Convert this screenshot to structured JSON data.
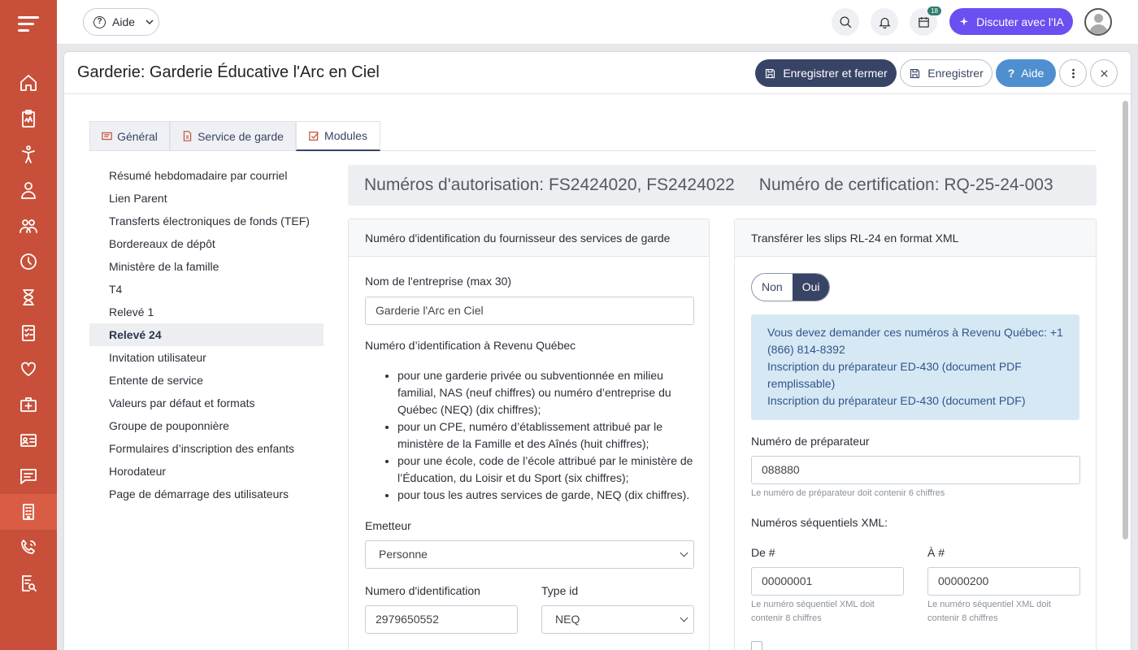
{
  "topbar": {
    "help_label": "Aide",
    "calendar_badge": "18",
    "ai_button": "Discuter avec l'IA"
  },
  "header": {
    "title": "Garderie: Garderie Éducative l'Arc en Ciel",
    "save_close": "Enregistrer et fermer",
    "save": "Enregistrer",
    "help": "Aide"
  },
  "tabs": [
    {
      "label": "Général"
    },
    {
      "label": "Service de garde"
    },
    {
      "label": "Modules"
    }
  ],
  "sidebar": {
    "items": [
      {
        "label": "Résumé hebdomadaire par courriel"
      },
      {
        "label": "Lien Parent"
      },
      {
        "label": "Transferts électroniques de fonds (TEF)"
      },
      {
        "label": "Bordereaux de dépôt"
      },
      {
        "label": "Ministère de la famille"
      },
      {
        "label": "T4"
      },
      {
        "label": "Relevé 1"
      },
      {
        "label": "Relevé 24"
      },
      {
        "label": "Invitation utilisateur"
      },
      {
        "label": "Entente de service"
      },
      {
        "label": "Valeurs par défaut et formats"
      },
      {
        "label": "Groupe de pouponnière"
      },
      {
        "label": "Formulaires d’inscription des enfants"
      },
      {
        "label": "Horodateur"
      },
      {
        "label": "Page de démarrage des utilisateurs"
      }
    ],
    "active_index": 7
  },
  "cert": {
    "authorization": "Numéros d'autorisation: FS2424020, FS2424022",
    "certification": "Numéro de certification: RQ-25-24-003"
  },
  "left_card": {
    "title": "Numéro d'identification du fournisseur des services de garde",
    "company_label": "Nom de l'entreprise (max 30)",
    "company_value": "Garderie l'Arc en Ciel",
    "rq_label": "Numéro d’identification à Revenu Québec",
    "bullets": [
      "pour une garderie privée ou subventionnée en milieu familial, NAS (neuf chiffres) ou numéro d’entreprise du Québec (NEQ) (dix chiffres);",
      "pour un CPE, numéro d’établissement attribué par le ministère de la Famille et des Aînés (huit chiffres);",
      "pour une école, code de l’école attribué par le ministère de l’Éducation, du Loisir et du Sport (six chiffres);",
      "pour tous les autres services de garde, NEQ (dix chiffres)."
    ],
    "emitter_label": "Emetteur",
    "emitter_value": "Personne",
    "id_label": "Numero d'identification",
    "id_value": "2979650552",
    "type_label": "Type id",
    "type_value": "NEQ"
  },
  "right_card": {
    "title": "Transférer les slips RL-24 en format XML",
    "toggle_no": "Non",
    "toggle_yes": "Oui",
    "alert_line1": "Vous devez demander ces numéros à Revenu Québec: +1 (866) 814-8392",
    "alert_line2": "Inscription du préparateur ED-430 (document PDF remplissable)",
    "alert_line3": "Inscription du préparateur ED-430 (document PDF)",
    "preparer_label": "Numéro de préparateur",
    "preparer_value": "088880",
    "preparer_help": "Le numéro de préparateur doit contenir 6 chiffres",
    "seq_label": "Numéros séquentiels XML:",
    "from_label": "De #",
    "from_value": "00000001",
    "from_help": "Le numéro séquentiel XML doit contenir 8 chiffres",
    "to_label": "À #",
    "to_value": "00000200",
    "to_help": "Le numéro séquentiel XML doit contenir 8 chiffres"
  },
  "colors": {
    "rail": "#c8503a",
    "primary_dark": "#384466",
    "ai": "#6c4ff0",
    "help_blue": "#4f8fd0"
  }
}
